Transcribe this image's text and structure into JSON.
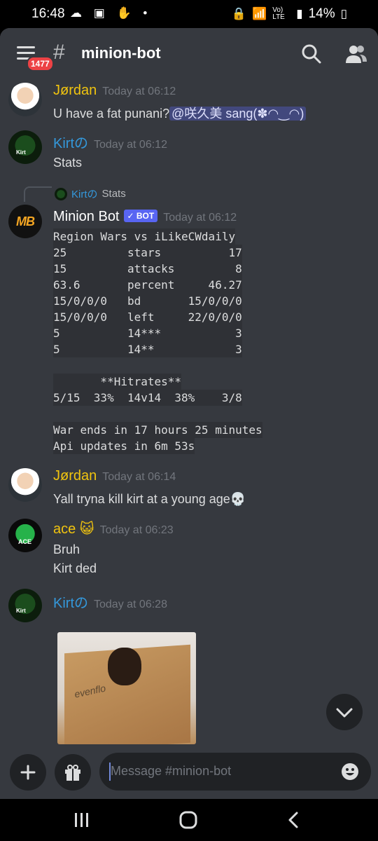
{
  "status_bar": {
    "time": "16:48",
    "signal_text": "Vo) LTE",
    "battery": "14%"
  },
  "header": {
    "badge_count": "1477",
    "channel_name": "minion-bot"
  },
  "messages": {
    "m1": {
      "author": "Jørdan",
      "timestamp": "Today at 06:12",
      "text": "U have a fat punani?",
      "mention": "@咲久美 sang(✽◠‿◠)"
    },
    "m2": {
      "author": "Kirtの",
      "timestamp": "Today at 06:12",
      "text": "Stats"
    },
    "m3": {
      "reply_author": "Kirtの",
      "reply_text": "Stats",
      "author": "Minion Bot",
      "bot_tag": "✓ BOT",
      "timestamp": "Today at 06:12",
      "code_lines": [
        "Region Wars vs iLikeCWdaily",
        "25         stars          17",
        "15         attacks         8",
        "63.6       percent     46.27",
        "15/0/0/0   bd       15/0/0/0",
        "15/0/0/0   left     22/0/0/0",
        "5          14***           3",
        "5          14**            3",
        "",
        "       **Hitrates**",
        "5/15  33%  14v14  38%    3/8",
        "",
        "War ends in 17 hours 25 minutes",
        "Api updates in 6m 53s"
      ]
    },
    "m4": {
      "author": "Jørdan",
      "timestamp": "Today at 06:14",
      "text": "Yall tryna kill kirt at a young age💀"
    },
    "m5": {
      "author": "ace 😺",
      "timestamp": "Today at 06:23",
      "line1": "Bruh",
      "line2": "Kirt ded"
    },
    "m6": {
      "author": "Kirtの",
      "timestamp": "Today at 06:28"
    }
  },
  "avatars": {
    "kirt_label": "Kirt",
    "mb_label": "MB",
    "ace_label": "ACE"
  },
  "attachment_logo": "evenflo",
  "composer": {
    "placeholder": "Message #minion-bot"
  },
  "colors": {
    "background": "#36393f",
    "jordan": "#f1c40f",
    "kirt": "#3498db",
    "mention": "#5865f2",
    "bot_badge": "#5865f2",
    "badge": "#ed4245"
  },
  "icons": [
    "menu-icon",
    "hash-icon",
    "search-icon",
    "members-icon",
    "plus-icon",
    "gift-icon",
    "emoji-icon",
    "chevron-down-icon",
    "recents-icon",
    "home-icon",
    "back-icon"
  ]
}
